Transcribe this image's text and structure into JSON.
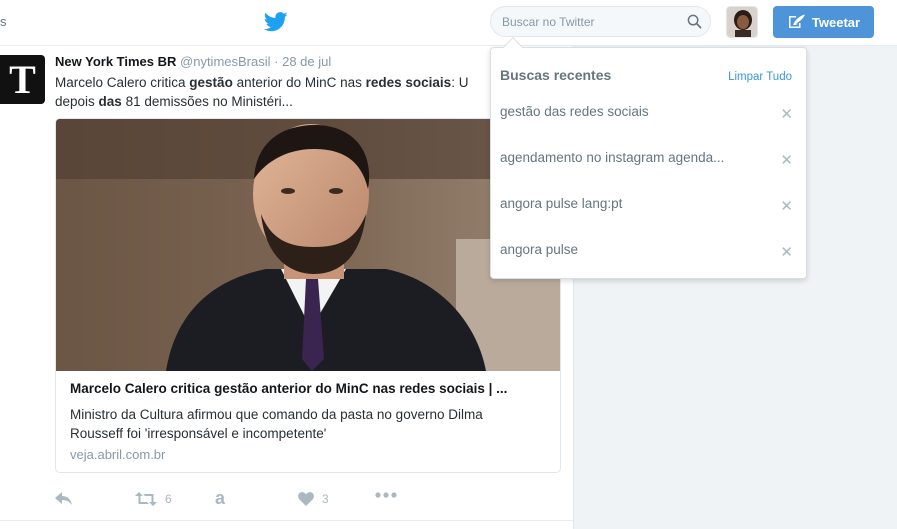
{
  "nav": {
    "edge_text": "s",
    "search": {
      "placeholder": "Buscar no Twitter"
    },
    "tweet_button": "Tweetar"
  },
  "tweet": {
    "author_name": "New York Times BR",
    "author_handle": "@nytimesBrasil",
    "separator": "·",
    "date": "28 de jul",
    "logo_letter": "T",
    "text": {
      "p1": "Marcelo Calero critica ",
      "b1": "gestão",
      "p2": " anterior do MinC nas ",
      "b2": "redes sociais",
      "p3": ": U",
      "p4": "depois ",
      "b3": "das",
      "p5": " 81 demissões no Ministéri..."
    },
    "card": {
      "title": "Marcelo Calero critica gestão anterior do MinC nas redes sociais | ...",
      "description_line1": "Ministro da Cultura afirmou que comando da pasta no governo Dilma",
      "description_line2": "Rousseff foi 'irresponsável e incompetente'",
      "url": "veja.abril.com.br"
    },
    "actions": {
      "retweet_count": "6",
      "like_count": "3",
      "extra_letter": "a"
    }
  },
  "dropdown": {
    "title": "Buscas recentes",
    "clear_label": "Limpar Tudo",
    "remove_glyph": "✕",
    "items": [
      {
        "label": "gestão das redes sociais"
      },
      {
        "label": "agendamento no instagram agenda..."
      },
      {
        "label": "angora pulse lang:pt"
      },
      {
        "label": "angora pulse"
      }
    ]
  },
  "colors": {
    "brand": "#1da1f2",
    "tweet_button": "#4d94d8",
    "link": "#3b94d9",
    "right_panel": "#f0f3f5"
  },
  "icons": {
    "logo": "twitter-bird-icon",
    "search": "search-icon",
    "compose": "compose-feather-icon",
    "reply": "reply-icon",
    "retweet": "retweet-icon",
    "like": "heart-icon",
    "more": "more-dots-icon",
    "remove": "close-icon"
  }
}
